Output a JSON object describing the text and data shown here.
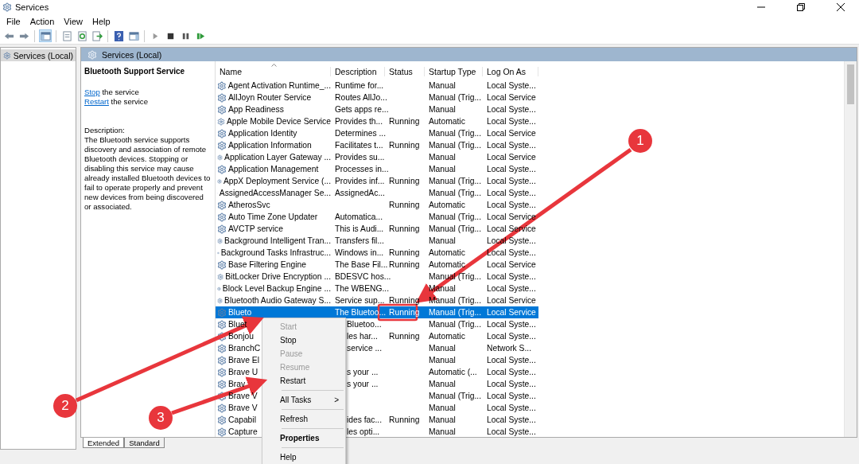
{
  "window": {
    "title": "Services"
  },
  "menu": [
    "File",
    "Action",
    "View",
    "Help"
  ],
  "toolbar": [
    {
      "kind": "back"
    },
    {
      "kind": "forward"
    },
    {
      "kind": "sep"
    },
    {
      "kind": "tree"
    },
    {
      "kind": "sep"
    },
    {
      "kind": "properties"
    },
    {
      "kind": "refresh"
    },
    {
      "kind": "export"
    },
    {
      "kind": "sep"
    },
    {
      "kind": "help"
    },
    {
      "kind": "pane"
    },
    {
      "kind": "sep"
    },
    {
      "kind": "play"
    },
    {
      "kind": "stop"
    },
    {
      "kind": "pause"
    },
    {
      "kind": "resume"
    }
  ],
  "tree": {
    "items": [
      {
        "label": "Services (Local)",
        "selected": true
      }
    ]
  },
  "panel": {
    "title": "Services (Local)"
  },
  "details": {
    "title": "Bluetooth Support Service",
    "actions": [
      {
        "link": "Stop",
        "text": "the service"
      },
      {
        "link": "Restart",
        "text": "the service"
      }
    ],
    "description_label": "Description:",
    "description": "The Bluetooth service supports discovery and association of remote Bluetooth devices.  Stopping or disabling this service may cause already installed Bluetooth devices to fail to operate properly and prevent new devices from being discovered or associated."
  },
  "table": {
    "columns": [
      "Name",
      "Description",
      "Status",
      "Startup Type",
      "Log On As"
    ],
    "rows": [
      {
        "cells": [
          "Agent Activation Runtime_...",
          "Runtime for...",
          "",
          "Manual",
          "Local Syste..."
        ],
        "selected": false,
        "obscured": false
      },
      {
        "cells": [
          "AllJoyn Router Service",
          "Routes AllJo...",
          "",
          "Manual (Trig...",
          "Local Service"
        ],
        "selected": false,
        "obscured": false
      },
      {
        "cells": [
          "App Readiness",
          "Gets apps re...",
          "",
          "Manual",
          "Local Syste..."
        ],
        "selected": false,
        "obscured": false
      },
      {
        "cells": [
          "Apple Mobile Device Service",
          "Provides th...",
          "Running",
          "Automatic",
          "Local Syste..."
        ],
        "selected": false,
        "obscured": false
      },
      {
        "cells": [
          "Application Identity",
          "Determines ...",
          "",
          "Manual (Trig...",
          "Local Service"
        ],
        "selected": false,
        "obscured": false
      },
      {
        "cells": [
          "Application Information",
          "Facilitates t...",
          "Running",
          "Manual (Trig...",
          "Local Syste..."
        ],
        "selected": false,
        "obscured": false
      },
      {
        "cells": [
          "Application Layer Gateway ...",
          "Provides su...",
          "",
          "Manual",
          "Local Service"
        ],
        "selected": false,
        "obscured": false
      },
      {
        "cells": [
          "Application Management",
          "Processes in...",
          "",
          "Manual",
          "Local Syste..."
        ],
        "selected": false,
        "obscured": false
      },
      {
        "cells": [
          "AppX Deployment Service (...",
          "Provides inf...",
          "Running",
          "Manual (Trig...",
          "Local Syste..."
        ],
        "selected": false,
        "obscured": false
      },
      {
        "cells": [
          "AssignedAccessManager Se...",
          "AssignedAc...",
          "",
          "Manual (Trig...",
          "Local Syste..."
        ],
        "selected": false,
        "obscured": false
      },
      {
        "cells": [
          "AtherosSvc",
          "",
          "Running",
          "Automatic",
          "Local Syste..."
        ],
        "selected": false
      },
      {
        "cells": [
          "Auto Time Zone Updater",
          "Automatica...",
          "",
          "Manual (Trig...",
          "Local Service"
        ],
        "selected": false,
        "obscured": false
      },
      {
        "cells": [
          "AVCTP service",
          "This is Audi...",
          "Running",
          "Manual (Trig...",
          "Local Service"
        ],
        "selected": false,
        "obscured": false
      },
      {
        "cells": [
          "Background Intelligent Tran...",
          "Transfers fil...",
          "",
          "Manual",
          "Local Syste..."
        ],
        "selected": false,
        "obscured": false
      },
      {
        "cells": [
          "Background Tasks Infrastruc...",
          "Windows in...",
          "Running",
          "Automatic",
          "Local Syste..."
        ],
        "selected": false,
        "obscured": false
      },
      {
        "cells": [
          "Base Filtering Engine",
          "The Base Fil...",
          "Running",
          "Automatic",
          "Local Service"
        ],
        "selected": false,
        "obscured": false
      },
      {
        "cells": [
          "BitLocker Drive Encryption ...",
          "BDESVC hos...",
          "",
          "Manual (Trig...",
          "Local Syste..."
        ],
        "selected": false,
        "obscured": false
      },
      {
        "cells": [
          "Block Level Backup Engine ...",
          "The WBENG...",
          "",
          "Manual",
          "Local Syste..."
        ],
        "selected": false,
        "obscured": false
      },
      {
        "cells": [
          "Bluetooth Audio Gateway S...",
          "Service sup...",
          "Running",
          "Manual (Trig...",
          "Local Service"
        ],
        "selected": false,
        "obscured": false
      },
      {
        "cells": [
          "Blueto",
          "The Bluetoo...",
          "Running",
          "Manual (Trig...",
          "Local Service"
        ],
        "selected": true,
        "obscured": false
      },
      {
        "cells": [
          "Bluet",
          "Bluetoo...",
          "",
          "Manual (Trig...",
          "Local Syste..."
        ],
        "selected": false,
        "obscured": true
      },
      {
        "cells": [
          "Bonjou",
          "les har...",
          "Running",
          "Automatic",
          "Local Syste..."
        ],
        "selected": false,
        "obscured": true
      },
      {
        "cells": [
          "BranchC",
          "service ...",
          "",
          "Manual",
          "Network S..."
        ],
        "selected": false,
        "obscured": true
      },
      {
        "cells": [
          "Brave El",
          "",
          "",
          "Manual",
          "Local Syste..."
        ],
        "selected": false
      },
      {
        "cells": [
          "Brave U",
          "s your ...",
          "",
          "Automatic (...",
          "Local Syste..."
        ],
        "selected": false,
        "obscured": true
      },
      {
        "cells": [
          "Brav",
          "s your ...",
          "",
          "Manual",
          "Local Syste..."
        ],
        "selected": false,
        "obscured": true
      },
      {
        "cells": [
          "Brave V",
          "",
          "",
          "Manual (Trig...",
          "Local Syste..."
        ],
        "selected": false
      },
      {
        "cells": [
          "Brave V",
          "",
          "",
          "Manual",
          "Local Syste..."
        ],
        "selected": false
      },
      {
        "cells": [
          "Capabil",
          "ides fac...",
          "Running",
          "Manual",
          "Local Syste..."
        ],
        "selected": false,
        "obscured": true
      },
      {
        "cells": [
          "Capture",
          "les opti...",
          "",
          "Manual",
          "Local Syste..."
        ],
        "selected": false,
        "obscured": true
      }
    ]
  },
  "context_menu": {
    "items": [
      {
        "kind": "item",
        "label": "Start",
        "disabled": true,
        "default": false
      },
      {
        "kind": "item",
        "label": "Stop",
        "disabled": false,
        "default": false
      },
      {
        "kind": "item",
        "label": "Pause",
        "disabled": true,
        "default": false
      },
      {
        "kind": "item",
        "label": "Resume",
        "disabled": true,
        "default": false
      },
      {
        "kind": "item",
        "label": "Restart",
        "disabled": false,
        "default": false
      },
      {
        "kind": "separator"
      },
      {
        "kind": "submenu",
        "label": "All Tasks",
        "arrow": ">",
        "disabled": false,
        "default": false
      },
      {
        "kind": "separator"
      },
      {
        "kind": "item",
        "label": "Refresh",
        "disabled": false,
        "default": false
      },
      {
        "kind": "separator"
      },
      {
        "kind": "item",
        "label": "Properties",
        "disabled": false,
        "default": true
      },
      {
        "kind": "separator"
      },
      {
        "kind": "item",
        "label": "Help",
        "disabled": false,
        "default": false
      }
    ]
  },
  "view_tabs": [
    {
      "label": "Extended",
      "selected": true
    },
    {
      "label": "Standard",
      "selected": false
    }
  ],
  "annotations": {
    "numbers": [
      "1",
      "2",
      "3"
    ]
  }
}
